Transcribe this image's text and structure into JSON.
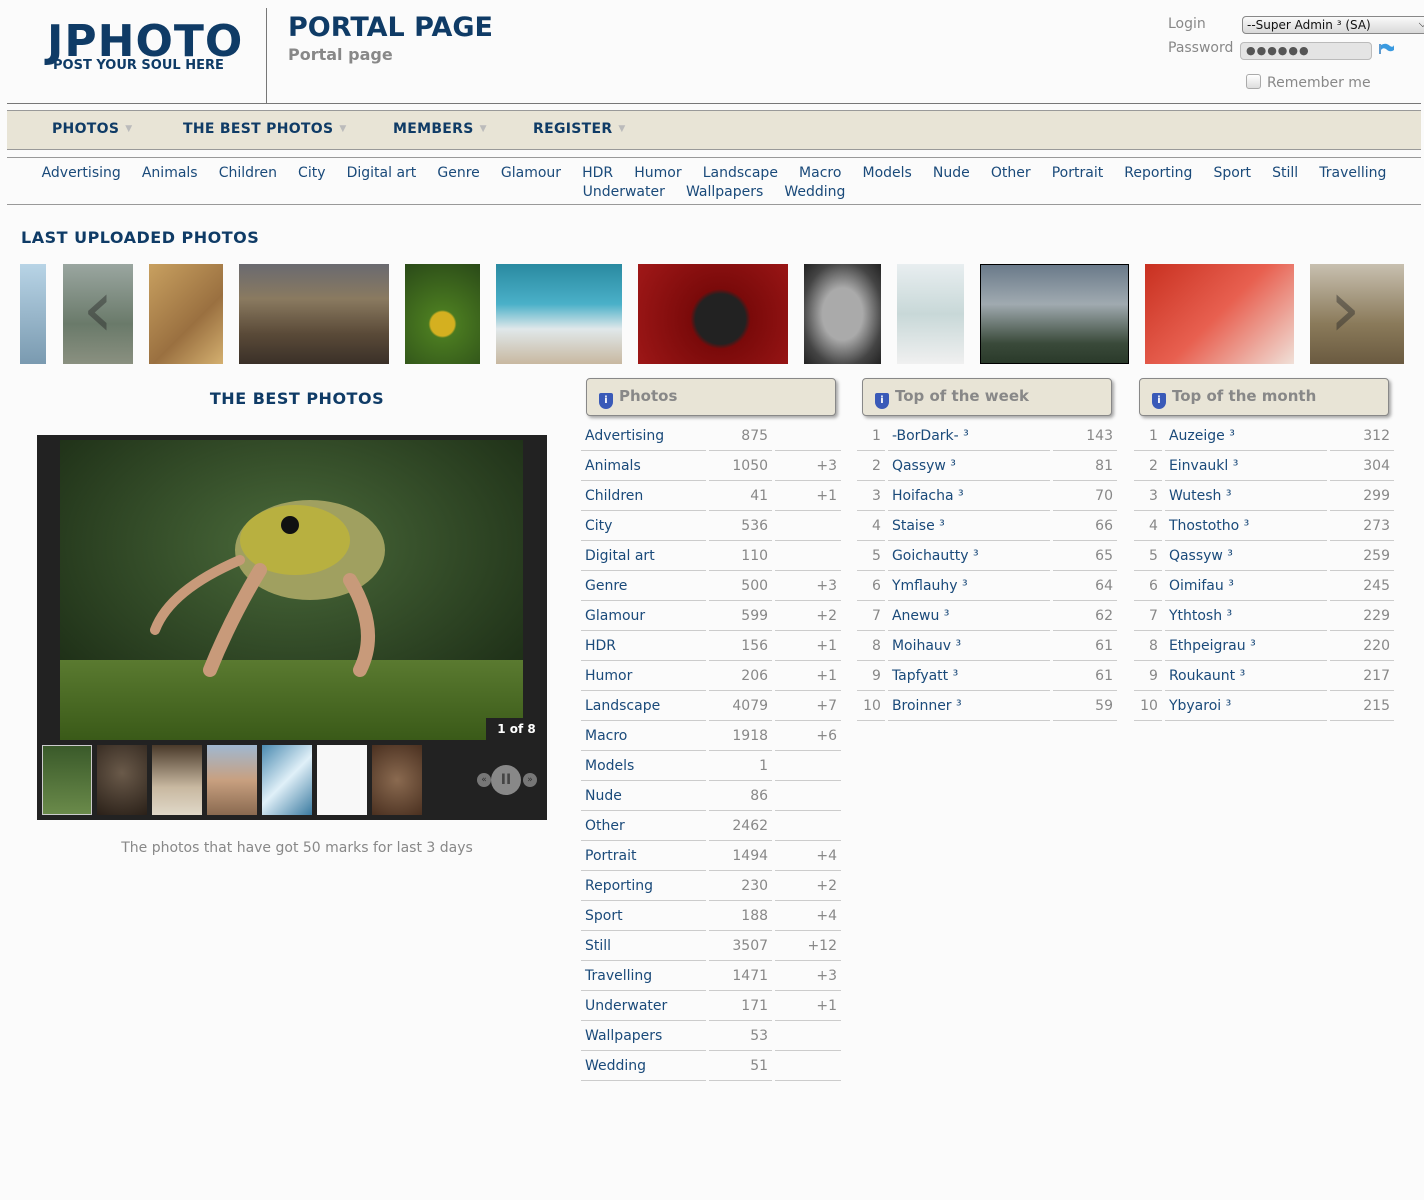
{
  "logo": {
    "main": "JPHOTO",
    "tagline": "POST YOUR SOUL HERE"
  },
  "page": {
    "title": "PORTAL PAGE",
    "subtitle": "Portal page"
  },
  "login": {
    "login_label": "Login",
    "login_value": "--Super Admin ³ (SA)",
    "password_label": "Password",
    "password_value": "●●●●●●",
    "remember_label": "Remember me"
  },
  "mainnav": [
    "PHOTOS",
    "THE BEST PHOTOS",
    "MEMBERS",
    "REGISTER"
  ],
  "categories_nav": [
    "Advertising",
    "Animals",
    "Children",
    "City",
    "Digital art",
    "Genre",
    "Glamour",
    "HDR",
    "Humor",
    "Landscape",
    "Macro",
    "Models",
    "Nude",
    "Other",
    "Portrait",
    "Reporting",
    "Sport",
    "Still",
    "Travelling",
    "Underwater",
    "Wallpapers",
    "Wedding"
  ],
  "last_uploaded": {
    "title": "LAST UPLOADED PHOTOS",
    "prev_arrow": "‹",
    "next_arrow": "›"
  },
  "best": {
    "title": "THE BEST PHOTOS",
    "counter": "1 of 8",
    "caption": "The photos that have got 50 marks for last 3 days",
    "prev": "«",
    "pause": "II",
    "next": "»"
  },
  "photos_table": {
    "header": "Photos",
    "rows": [
      {
        "name": "Advertising",
        "count": "875",
        "diff": ""
      },
      {
        "name": "Animals",
        "count": "1050",
        "diff": "+3"
      },
      {
        "name": "Children",
        "count": "41",
        "diff": "+1"
      },
      {
        "name": "City",
        "count": "536",
        "diff": ""
      },
      {
        "name": "Digital art",
        "count": "110",
        "diff": ""
      },
      {
        "name": "Genre",
        "count": "500",
        "diff": "+3"
      },
      {
        "name": "Glamour",
        "count": "599",
        "diff": "+2"
      },
      {
        "name": "HDR",
        "count": "156",
        "diff": "+1"
      },
      {
        "name": "Humor",
        "count": "206",
        "diff": "+1"
      },
      {
        "name": "Landscape",
        "count": "4079",
        "diff": "+7"
      },
      {
        "name": "Macro",
        "count": "1918",
        "diff": "+6"
      },
      {
        "name": "Models",
        "count": "1",
        "diff": ""
      },
      {
        "name": "Nude",
        "count": "86",
        "diff": ""
      },
      {
        "name": "Other",
        "count": "2462",
        "diff": ""
      },
      {
        "name": "Portrait",
        "count": "1494",
        "diff": "+4"
      },
      {
        "name": "Reporting",
        "count": "230",
        "diff": "+2"
      },
      {
        "name": "Sport",
        "count": "188",
        "diff": "+4"
      },
      {
        "name": "Still",
        "count": "3507",
        "diff": "+12"
      },
      {
        "name": "Travelling",
        "count": "1471",
        "diff": "+3"
      },
      {
        "name": "Underwater",
        "count": "171",
        "diff": "+1"
      },
      {
        "name": "Wallpapers",
        "count": "53",
        "diff": ""
      },
      {
        "name": "Wedding",
        "count": "51",
        "diff": ""
      }
    ]
  },
  "week_table": {
    "header": "Top of the week",
    "rows": [
      {
        "rank": "1",
        "user": "-BorDark- ³",
        "score": "143"
      },
      {
        "rank": "2",
        "user": "Qassyw ³",
        "score": "81"
      },
      {
        "rank": "3",
        "user": "Hoifacha ³",
        "score": "70"
      },
      {
        "rank": "4",
        "user": "Staise ³",
        "score": "66"
      },
      {
        "rank": "5",
        "user": "Goichautty ³",
        "score": "65"
      },
      {
        "rank": "6",
        "user": "Ymflauhy ³",
        "score": "64"
      },
      {
        "rank": "7",
        "user": "Anewu ³",
        "score": "62"
      },
      {
        "rank": "8",
        "user": "Moihauv ³",
        "score": "61"
      },
      {
        "rank": "9",
        "user": "Tapfyatt ³",
        "score": "61"
      },
      {
        "rank": "10",
        "user": "Broinner ³",
        "score": "59"
      }
    ]
  },
  "month_table": {
    "header": "Top of the month",
    "rows": [
      {
        "rank": "1",
        "user": "Auzeige ³",
        "score": "312"
      },
      {
        "rank": "2",
        "user": "Einvaukl ³",
        "score": "304"
      },
      {
        "rank": "3",
        "user": "Wutesh ³",
        "score": "299"
      },
      {
        "rank": "4",
        "user": "Thostotho ³",
        "score": "273"
      },
      {
        "rank": "5",
        "user": "Qassyw ³",
        "score": "259"
      },
      {
        "rank": "6",
        "user": "Oimifau ³",
        "score": "245"
      },
      {
        "rank": "7",
        "user": "Ythtosh ³",
        "score": "229"
      },
      {
        "rank": "8",
        "user": "Ethpeigrau ³",
        "score": "220"
      },
      {
        "rank": "9",
        "user": "Roukaunt ³",
        "score": "217"
      },
      {
        "rank": "10",
        "user": "Ybyaroi ³",
        "score": "215"
      }
    ]
  }
}
